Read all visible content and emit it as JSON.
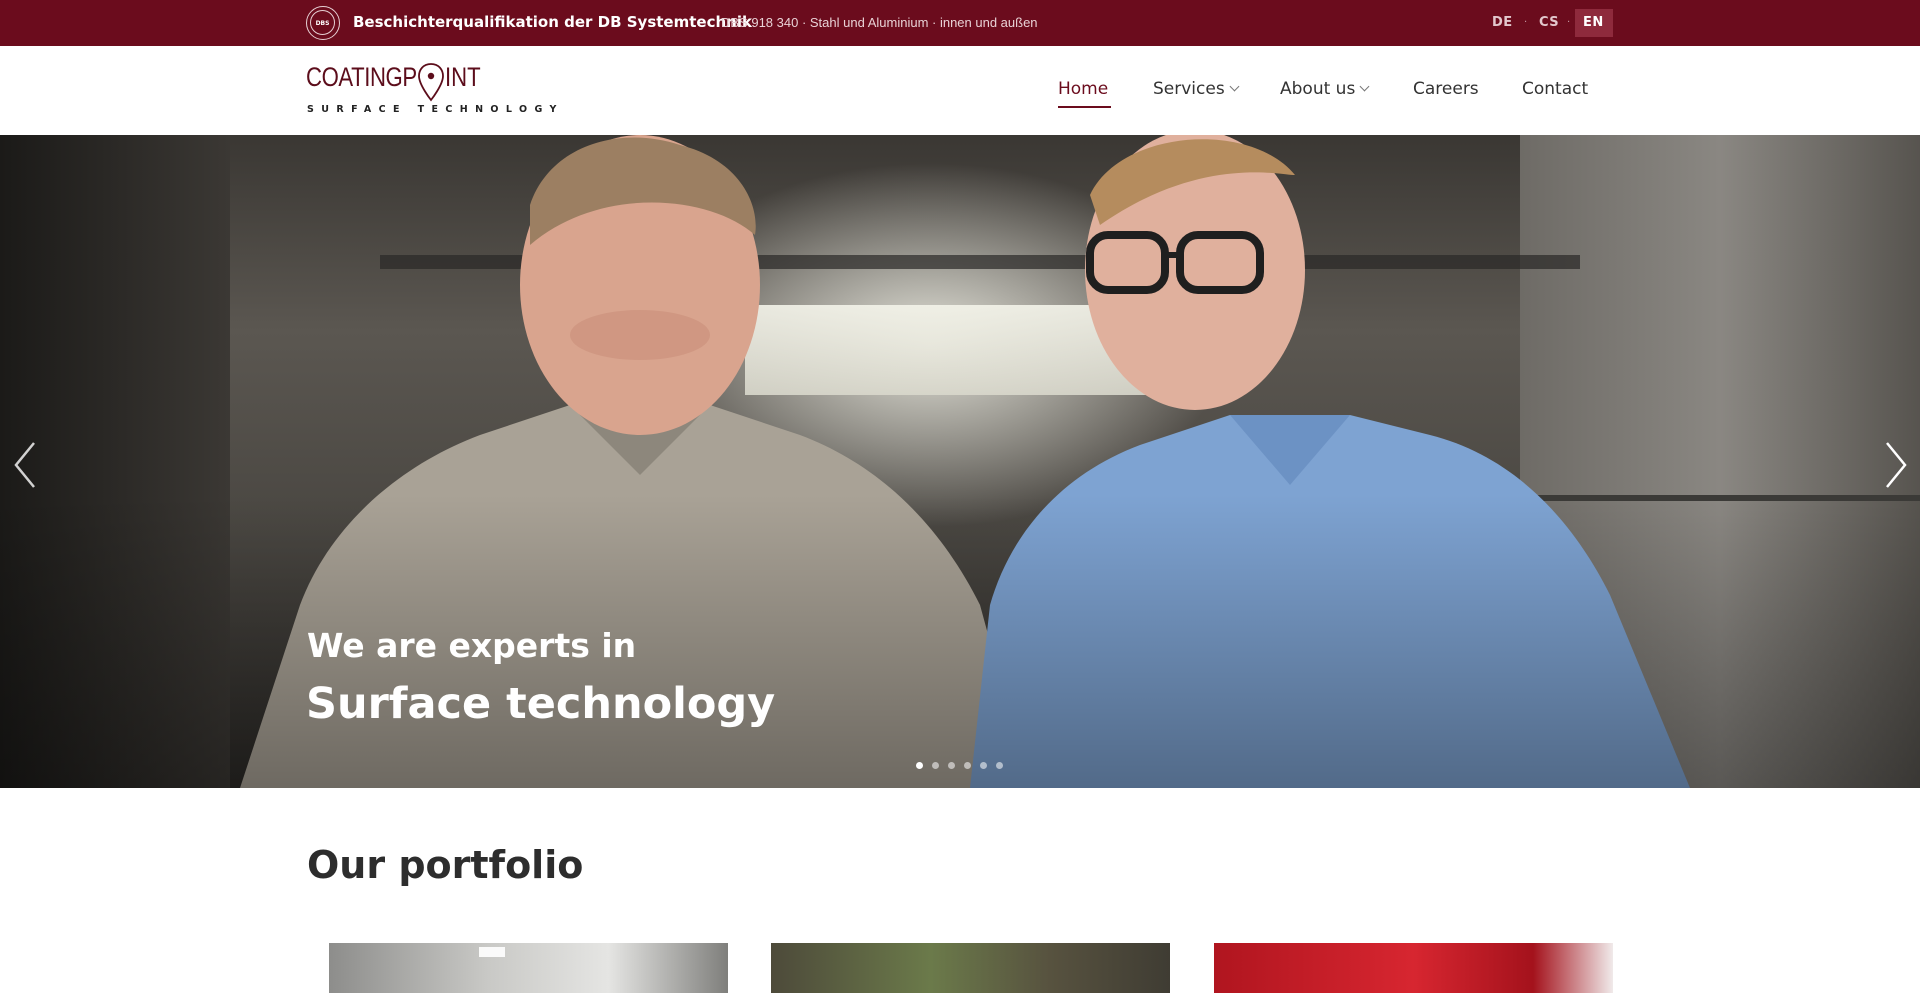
{
  "topbar": {
    "seal_text": "DBS",
    "qualification_title": "Beschichterqualifikation der DB Systemtechnik",
    "qualification_sub": "DBS 918 340 · Stahl und Aluminium · innen und außen",
    "languages": [
      {
        "code": "DE",
        "active": false
      },
      {
        "code": "CS",
        "active": false
      },
      {
        "code": "EN",
        "active": true
      }
    ],
    "separator": "·"
  },
  "logo": {
    "word_left": "COATINGP",
    "word_right": "INT",
    "tagline": "SURFACE TECHNOLOGY",
    "icon": "map-pin-icon"
  },
  "nav": {
    "items": [
      {
        "label": "Home",
        "active": true,
        "dropdown": false
      },
      {
        "label": "Services",
        "active": false,
        "dropdown": true
      },
      {
        "label": "About us",
        "active": false,
        "dropdown": true
      },
      {
        "label": "Careers",
        "active": false,
        "dropdown": false
      },
      {
        "label": "Contact",
        "active": false,
        "dropdown": false
      }
    ]
  },
  "hero": {
    "caption_line1": "We are experts in",
    "caption_line2": "Surface technology",
    "slide_count": 6,
    "active_slide": 1,
    "prev_icon": "chevron-left-icon",
    "next_icon": "chevron-right-icon"
  },
  "portfolio": {
    "title": "Our portfolio",
    "card_count": 3
  },
  "colors": {
    "brand": "#6b0c1d",
    "topbar_bg": "#6b0c1d",
    "text": "#2d2d2d",
    "white": "#ffffff"
  }
}
